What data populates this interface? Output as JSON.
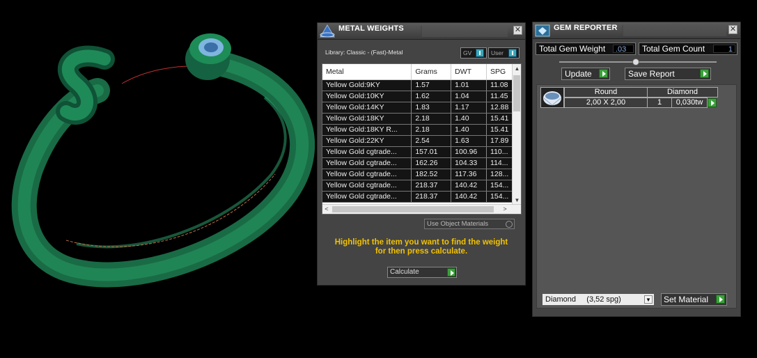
{
  "metal_weights": {
    "title": "METAL WEIGHTS",
    "library": "Library: Classic - (Fast)-Metal",
    "gv_label": "GV",
    "user_label": "User",
    "columns": [
      "Metal",
      "Grams",
      "DWT",
      "SPG"
    ],
    "rows": [
      {
        "metal": "Yellow Gold:9KY",
        "grams": "1.57",
        "dwt": "1.01",
        "spg": "11.08"
      },
      {
        "metal": "Yellow Gold:10KY",
        "grams": "1.62",
        "dwt": "1.04",
        "spg": "11.45"
      },
      {
        "metal": "Yellow Gold:14KY",
        "grams": "1.83",
        "dwt": "1.17",
        "spg": "12.88"
      },
      {
        "metal": "Yellow Gold:18KY",
        "grams": "2.18",
        "dwt": "1.40",
        "spg": "15.41"
      },
      {
        "metal": "Yellow Gold:18KY R...",
        "grams": "2.18",
        "dwt": "1.40",
        "spg": "15.41"
      },
      {
        "metal": "Yellow Gold:22KY",
        "grams": "2.54",
        "dwt": "1.63",
        "spg": "17.89"
      },
      {
        "metal": "Yellow Gold cgtrade...",
        "grams": "157.01",
        "dwt": "100.96",
        "spg": "110..."
      },
      {
        "metal": "Yellow Gold cgtrade...",
        "grams": "162.26",
        "dwt": "104.33",
        "spg": "114..."
      },
      {
        "metal": "Yellow Gold cgtrade...",
        "grams": "182.52",
        "dwt": "117.36",
        "spg": "128..."
      },
      {
        "metal": "Yellow Gold cgtrade...",
        "grams": "218.37",
        "dwt": "140.42",
        "spg": "154..."
      },
      {
        "metal": "Yellow Gold cgtrade...",
        "grams": "218.37",
        "dwt": "140.42",
        "spg": "154..."
      }
    ],
    "use_object_materials": "Use Object Materials",
    "hint_line1": "Highlight the item you want to find the weight",
    "hint_line2": "for then press calculate.",
    "calculate_label": "Calculate"
  },
  "gem_reporter": {
    "title": "GEM REPORTER",
    "total_weight_label": "Total Gem Weight",
    "total_weight_value": ".03",
    "total_count_label": "Total Gem Count",
    "total_count_value": "1",
    "update_label": "Update",
    "save_report_label": "Save Report",
    "gem": {
      "shape": "Round",
      "material": "Diamond",
      "size": "2,00 X 2,00",
      "count": "1",
      "weight": "0,030tw"
    },
    "material_select": "Diamond     (3,52 spg)",
    "set_material_label": "Set Material"
  }
}
